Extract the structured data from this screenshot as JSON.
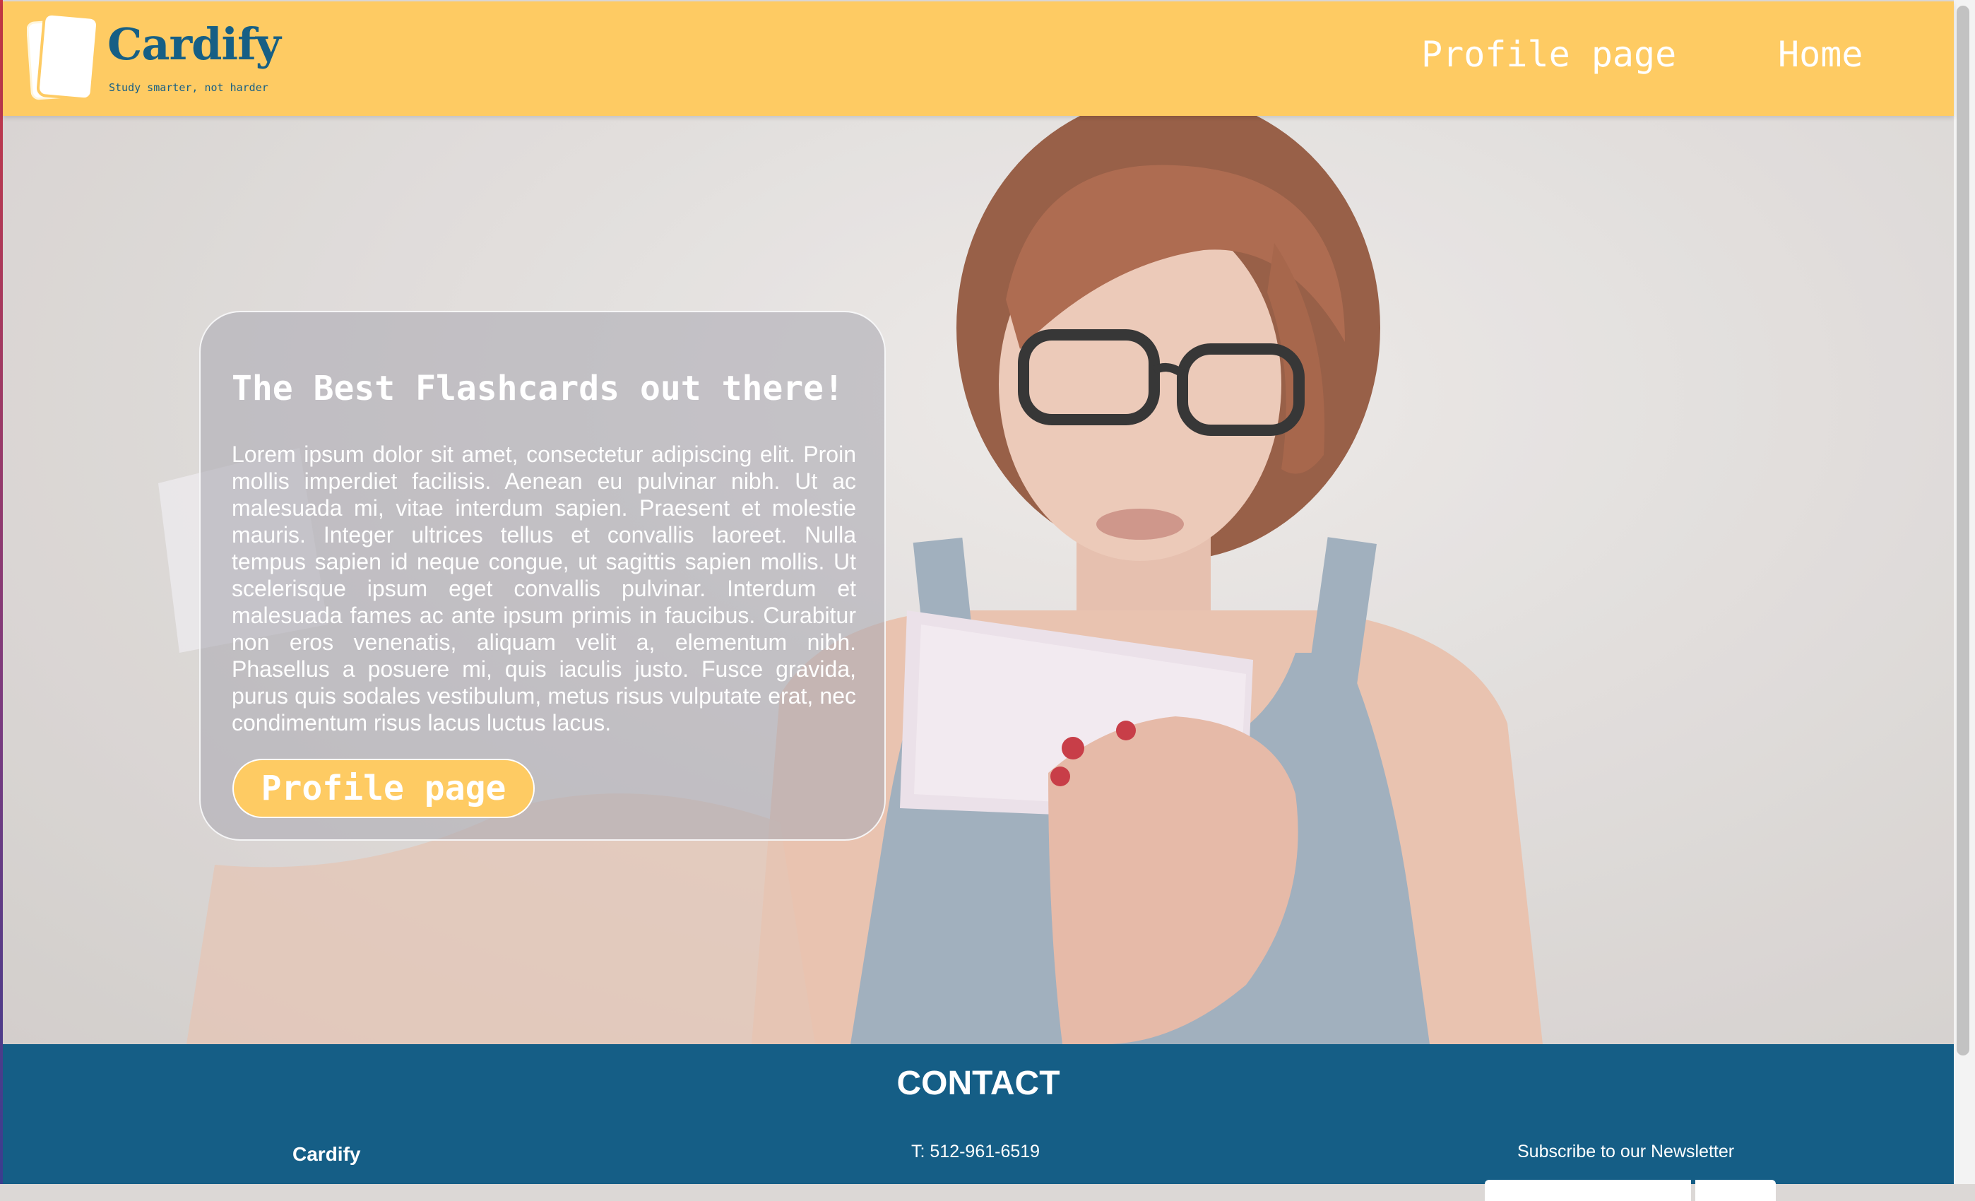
{
  "header": {
    "brand_name": "Cardify",
    "tagline": "Study smarter, not harder",
    "nav": [
      {
        "label": "Profile page"
      },
      {
        "label": "Home"
      }
    ]
  },
  "hero": {
    "title": "The Best Flashcards out there!",
    "body": "Lorem ipsum dolor sit amet, consectetur adipiscing elit. Proin mollis imperdiet facilisis. Aenean eu pulvinar nibh. Ut ac malesuada mi, vitae interdum sapien. Praesent et molestie mauris. Integer ultrices tellus et convallis laoreet. Nulla tempus sapien id neque congue, ut sagittis sapien mollis. Ut scelerisque ipsum eget convallis pulvinar. Interdum et malesuada fames ac ante ipsum primis in faucibus. Curabitur non eros venenatis, aliquam velit a, elementum nibh. Phasellus a posuere mi, quis iaculis justo. Fusce gravida, purus quis sodales vestibulum, metus risus vulputate erat, nec condimentum risus lacus luctus lacus.",
    "button_label": "Profile page"
  },
  "footer": {
    "heading": "CONTACT",
    "brand": "Cardify",
    "phone": "T: 512-961-6519",
    "newsletter_label": "Subscribe to our Newsletter"
  },
  "colors": {
    "header_bg": "#fecb63",
    "brand_blue": "#165f85",
    "footer_bg": "#155e86",
    "white": "#ffffff"
  },
  "icons": {
    "logo": "flashcard-stack-icon"
  }
}
